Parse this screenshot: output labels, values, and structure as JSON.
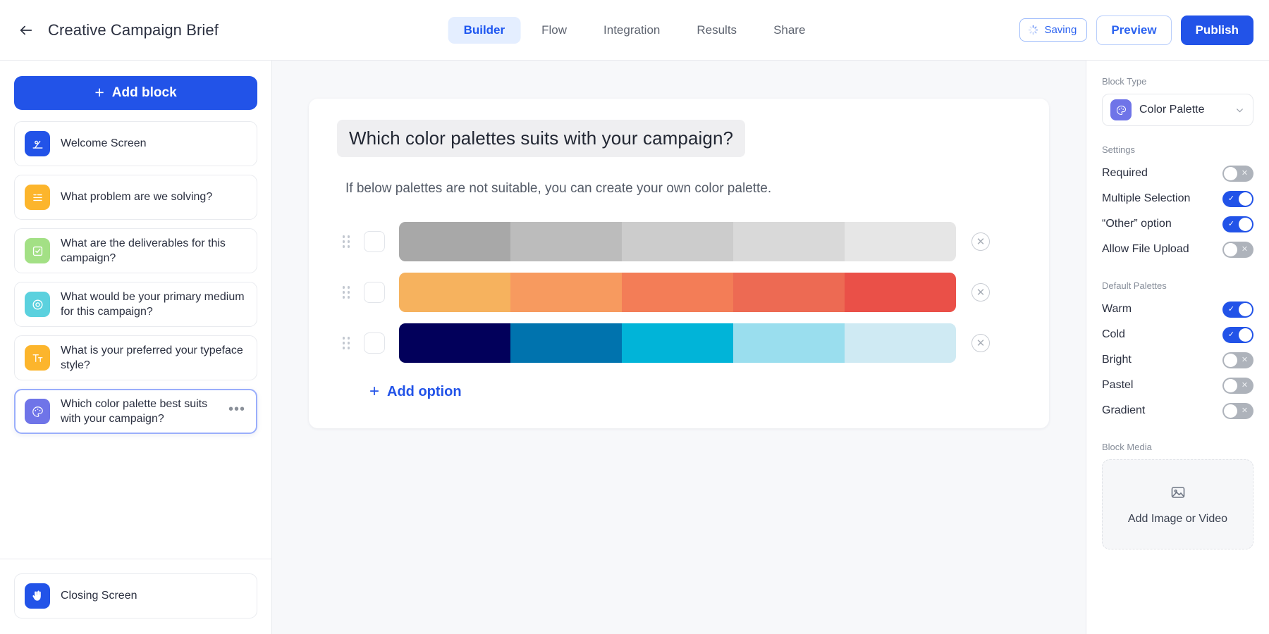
{
  "header": {
    "back_icon": "arrow-left-icon",
    "title": "Creative Campaign Brief",
    "tabs": [
      {
        "label": "Builder",
        "active": true
      },
      {
        "label": "Flow",
        "active": false
      },
      {
        "label": "Integration",
        "active": false
      },
      {
        "label": "Results",
        "active": false
      },
      {
        "label": "Share",
        "active": false
      }
    ],
    "saving_label": "Saving",
    "saving_icon": "spinner-icon",
    "preview_label": "Preview",
    "publish_label": "Publish"
  },
  "sidebar": {
    "add_block_label": "Add block",
    "blocks": [
      {
        "label": "Welcome Screen",
        "icon": "welcome-screen-icon",
        "color": "#2253e8",
        "selected": false,
        "menu": false
      },
      {
        "label": "What problem are we solving?",
        "icon": "long-text-icon",
        "color": "#fcb52c",
        "selected": false,
        "menu": false
      },
      {
        "label": "What are the deliverables for this campaign?",
        "icon": "checkbox-icon",
        "color": "#a3e085",
        "selected": false,
        "menu": false
      },
      {
        "label": "What would be your primary medium for this campaign?",
        "icon": "radio-target-icon",
        "color": "#5bd1de",
        "selected": false,
        "menu": false
      },
      {
        "label": "What is your preferred your typeface style?",
        "icon": "typeface-icon",
        "color": "#fcb52c",
        "selected": false,
        "menu": false
      },
      {
        "label": "Which color palette best suits with your campaign?",
        "icon": "palette-icon",
        "color": "#6f74e8",
        "selected": true,
        "menu": true
      }
    ],
    "menu_glyph": "•••",
    "footer_block": {
      "label": "Closing Screen",
      "icon": "wave-hand-icon",
      "color": "#2253e8"
    }
  },
  "canvas": {
    "question_title": "Which color palettes suits with your campaign?",
    "question_description": "If below palettes are not suitable, you can create your own color palette.",
    "add_option_label": "Add option",
    "remove_glyph": "✕",
    "options": [
      {
        "name": "grey-palette",
        "checked": false,
        "colors": [
          "#a8a8a8",
          "#bcbcbc",
          "#cccccc",
          "#d9d9d9",
          "#e6e6e6"
        ]
      },
      {
        "name": "warm-palette",
        "checked": false,
        "colors": [
          "#f6b25e",
          "#f79a5f",
          "#f37d57",
          "#ed6a53",
          "#ea5048"
        ]
      },
      {
        "name": "cold-palette",
        "checked": false,
        "colors": [
          "#02005b",
          "#0073ae",
          "#01b4d8",
          "#9adeee",
          "#cfeaf3"
        ]
      }
    ]
  },
  "right_panel": {
    "block_type_label": "Block Type",
    "block_type_value": "Color Palette",
    "block_type_icon": "palette-icon",
    "chevron_icon": "chevron-down-icon",
    "settings_label": "Settings",
    "settings": [
      {
        "label": "Required",
        "on": false
      },
      {
        "label": "Multiple Selection",
        "on": true
      },
      {
        "label": "“Other” option",
        "on": true
      },
      {
        "label": "Allow File Upload",
        "on": false
      }
    ],
    "default_palettes_label": "Default Palettes",
    "default_palettes": [
      {
        "label": "Warm",
        "on": true
      },
      {
        "label": "Cold",
        "on": true
      },
      {
        "label": "Bright",
        "on": false
      },
      {
        "label": "Pastel",
        "on": false
      },
      {
        "label": "Gradient",
        "on": false
      }
    ],
    "toggle_on_glyph": "✓",
    "toggle_off_glyph": "✕",
    "block_media_label": "Block Media",
    "media_placeholder": "Add Image or Video",
    "media_icon": "image-icon"
  },
  "colors": {
    "accent": "#2253e8",
    "accent_soft": "#e4eeff",
    "canvas_bg": "#f7f8fa",
    "toggle_off": "#aeb3bb"
  }
}
